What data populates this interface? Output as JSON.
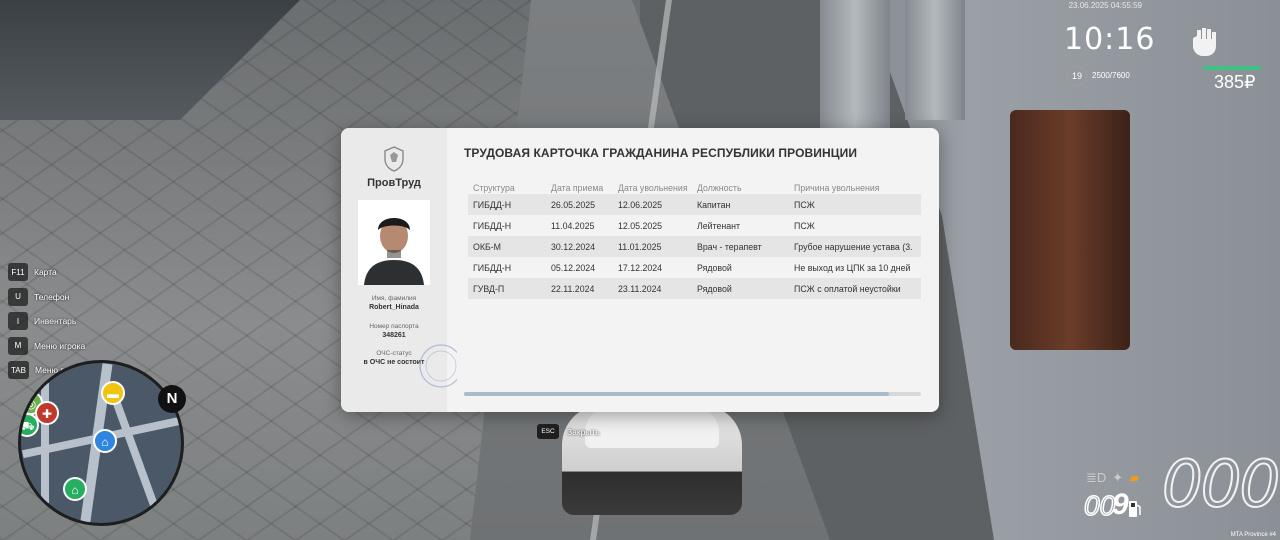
{
  "hud": {
    "datetime": "23.06.2025 04:55:59",
    "clock": "10:16",
    "level": "19",
    "experience": "2500/7600",
    "money": "385₽",
    "health_color": "#3cc383"
  },
  "keybinds": [
    {
      "key": "F11",
      "label": "Карта"
    },
    {
      "key": "U",
      "label": "Телефон"
    },
    {
      "key": "I",
      "label": "Инвентарь"
    },
    {
      "key": "M",
      "label": "Меню игрока"
    },
    {
      "key": "TAB",
      "label": "Меню взаимодействия"
    }
  ],
  "minimap": {
    "north_label": "N"
  },
  "vehicle": {
    "speed": "000",
    "fuel_small": "00",
    "fuel_gear": "9"
  },
  "watermark": "MTA Province #4",
  "card": {
    "org_name": "ПровТруд",
    "title": "ТРУДОВАЯ КАРТОЧКА ГРАЖДАНИНА РЕСПУБЛИКИ ПРОВИНЦИИ",
    "name_label": "Имя, фамилия",
    "name_value": "Robert_Hinada",
    "passport_label": "Номер паспорта",
    "passport_value": "348261",
    "ochs_label": "ОЧС-статус",
    "ochs_value": "в ОЧС не состоит",
    "columns": [
      "Структура",
      "Дата приема",
      "Дата увольнения",
      "Должность",
      "Причина увольнения"
    ],
    "rows": [
      [
        "ГИБДД-Н",
        "26.05.2025",
        "12.06.2025",
        "Капитан",
        "ПСЖ"
      ],
      [
        "ГИБДД-Н",
        "11.04.2025",
        "12.05.2025",
        "Лейтенант",
        "ПСЖ"
      ],
      [
        "ОКБ-М",
        "30.12.2024",
        "11.01.2025",
        "Врач - терапевт",
        "Грубое нарушение устава (3."
      ],
      [
        "ГИБДД-Н",
        "05.12.2024",
        "17.12.2024",
        "Рядовой",
        "Не выход из ЦПК за 10 дней"
      ],
      [
        "ГУВД-П",
        "22.11.2024",
        "23.11.2024",
        "Рядовой",
        "ПСЖ с оплатой неустойки"
      ]
    ],
    "scroll_position": 0.93,
    "accent_color": "#a9bccc"
  },
  "close_hint": {
    "key": "ESC",
    "label": "Закрыть"
  }
}
